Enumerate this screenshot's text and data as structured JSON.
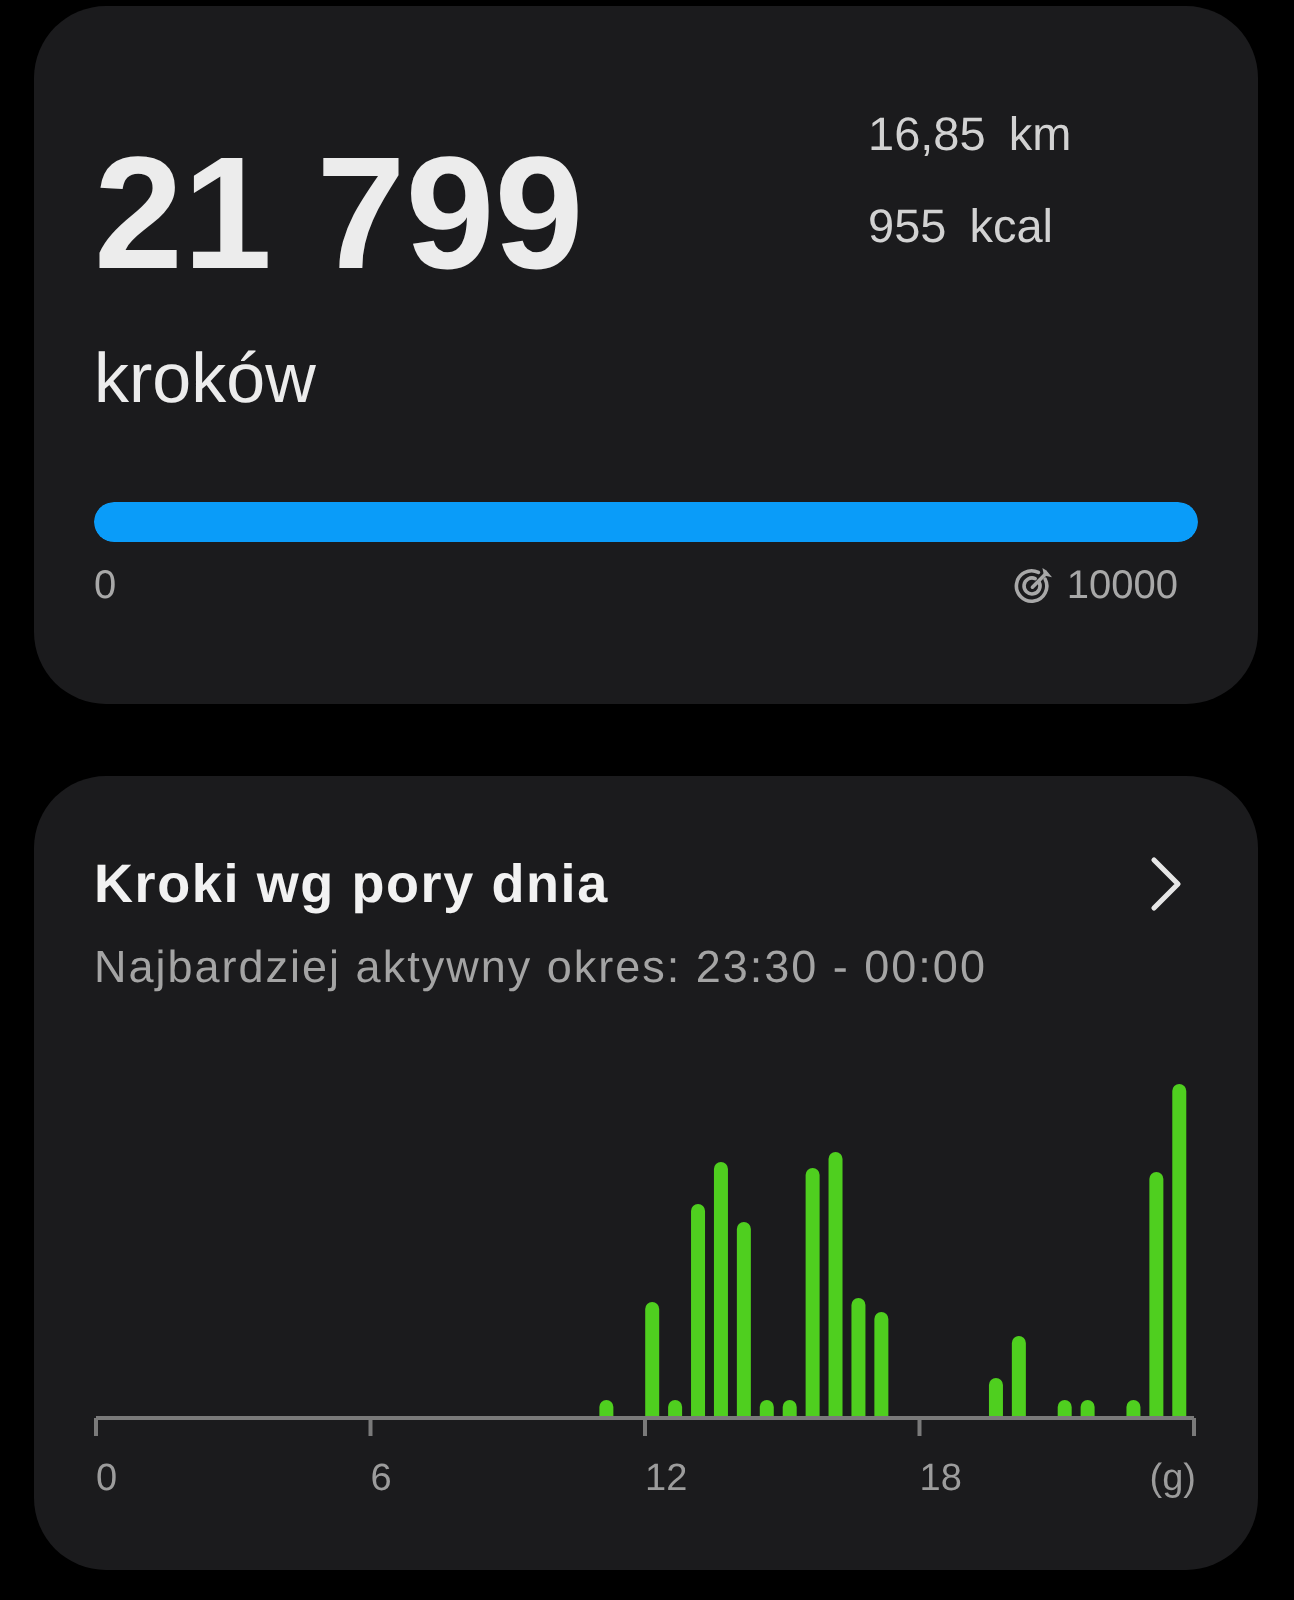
{
  "steps_card": {
    "value": "21 799",
    "unit": "kroków",
    "distance": "16,85 km",
    "calories": "955 kcal",
    "progress": {
      "level": 1,
      "min_label": "0",
      "goal_label": "10000"
    }
  },
  "time_of_day_card": {
    "title": "Kroki wg pory dnia",
    "subtitle": "Najbardziej aktywny okres: 23:30 - 00:00",
    "chart": {
      "axis_labels": [
        "0",
        "6",
        "12",
        "18",
        "(g)"
      ]
    }
  }
}
